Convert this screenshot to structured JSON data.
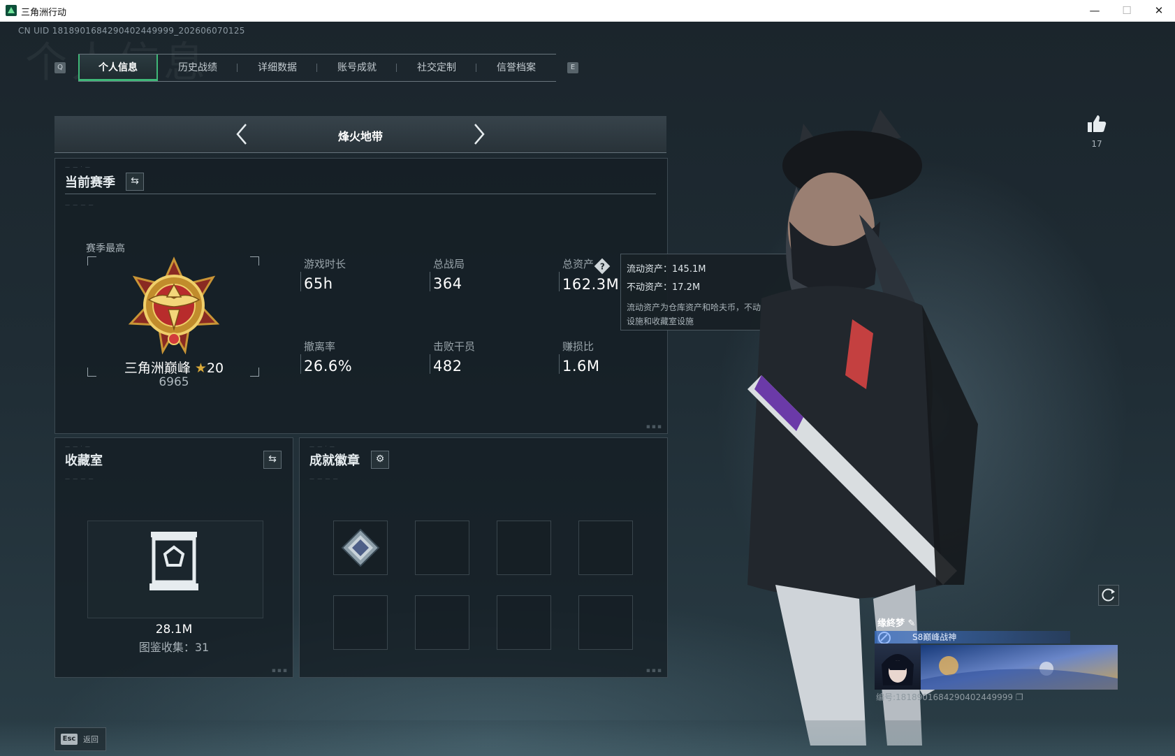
{
  "window": {
    "title": "三角洲行动"
  },
  "header": {
    "uid": "CN UID 1818901684290402449999_202606070125",
    "watermark": "个人信息",
    "key_left": "Q",
    "key_right": "E",
    "tabs": [
      {
        "label": "个人信息",
        "active": true
      },
      {
        "label": "历史战绩"
      },
      {
        "label": "详细数据"
      },
      {
        "label": "账号成就"
      },
      {
        "label": "社交定制"
      },
      {
        "label": "信誉档案"
      }
    ]
  },
  "mode": {
    "title": "烽火地带"
  },
  "season": {
    "title": "当前赛季",
    "best_label": "赛季最高",
    "rank_name": "三角洲巅峰",
    "rank_stars": "20",
    "rank_score": "6965",
    "stats": [
      {
        "label": "游戏时长",
        "value": "65h"
      },
      {
        "label": "总战局",
        "value": "364"
      },
      {
        "label": "总资产",
        "value": "162.3M"
      },
      {
        "label": "撤离率",
        "value": "26.6%"
      },
      {
        "label": "击败干员",
        "value": "482"
      },
      {
        "label": "赚损比",
        "value": "1.6M"
      }
    ]
  },
  "tooltip": {
    "liquid": "流动资产：145.1M",
    "fixed": "不动资产：17.2M",
    "note": "流动资产为仓库资产和哈夫币，不动资产为特勤处设施和收藏室设施"
  },
  "collection": {
    "title": "收藏室",
    "value": "28.1M",
    "count": "图鉴收集：31"
  },
  "badges": {
    "title": "成就徽章",
    "slots": 8,
    "filled": 1
  },
  "profile": {
    "likes": "17",
    "name": "缘終梦",
    "title": "S8巅峰战神",
    "id_text": "编号:1818901684290402449999"
  },
  "footer": {
    "esc_key": "Esc",
    "back_label": "返回"
  },
  "colors": {
    "accent": "#3fb878",
    "gold": "#d8a93a"
  }
}
